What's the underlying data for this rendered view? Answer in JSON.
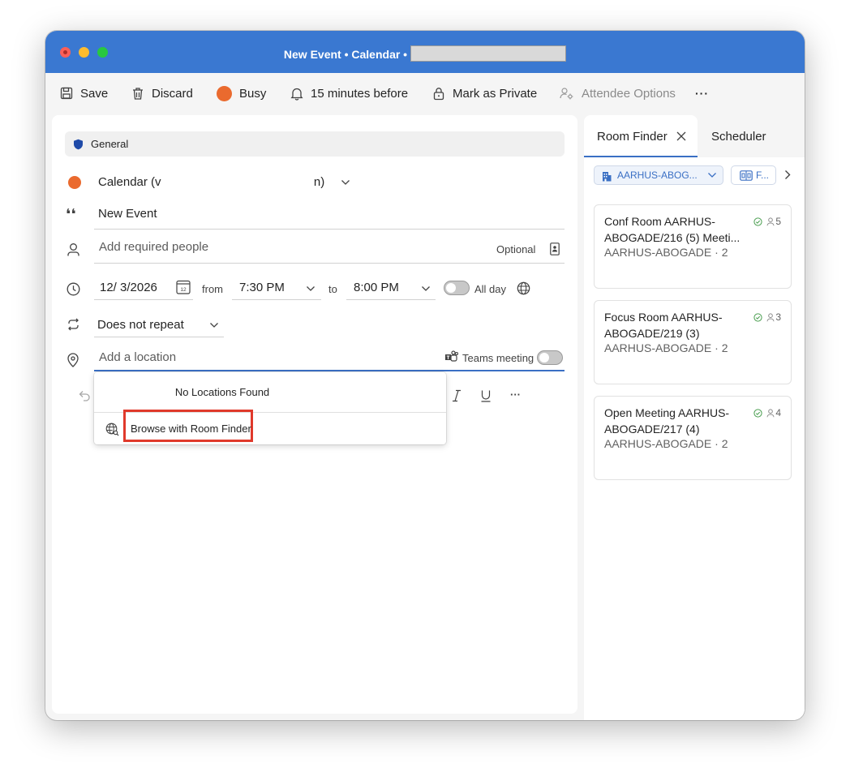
{
  "window": {
    "title": "New Event • Calendar •"
  },
  "toolbar": {
    "save": "Save",
    "discard": "Discard",
    "busy": "Busy",
    "reminder": "15 minutes before",
    "private": "Mark as Private",
    "attendee_options": "Attendee Options",
    "more": "···",
    "busy_color": "#ea6a2e"
  },
  "form": {
    "label_chip": "General",
    "calendar_name": "Calendar (v",
    "calendar_suffix": "n)",
    "calendar_color": "#ea6a2e",
    "title_value": "New Event",
    "people_placeholder": "Add required people",
    "optional_label": "Optional",
    "date_value": "12/ 3/2026",
    "from_label": "from",
    "start_time": "7:30 PM",
    "to_label": "to",
    "end_time": "8:00 PM",
    "all_day_label": "All day",
    "repeat_value": "Does not repeat",
    "location_placeholder": "Add a location",
    "teams_label": "Teams meeting",
    "more_format": "···"
  },
  "location_dropdown": {
    "empty_message": "No Locations Found",
    "browse_label": "Browse with Room Finder"
  },
  "side_panel": {
    "tabs": [
      {
        "label": "Room Finder",
        "active": true
      },
      {
        "label": "Scheduler",
        "active": false
      }
    ],
    "filter_building": "AARHUS-ABOG...",
    "filter_features": "F...",
    "rooms": [
      {
        "name": "Conf Room AARHUS-ABOGADE/216 (5) Meeti...",
        "sub": "AARHUS-ABOGADE · 2",
        "capacity": "5"
      },
      {
        "name": "Focus Room AARHUS-ABOGADE/219 (3)",
        "sub": "AARHUS-ABOGADE · 2",
        "capacity": "3"
      },
      {
        "name": "Open Meeting AARHUS-ABOGADE/217 (4)",
        "sub": "AARHUS-ABOGADE · 2",
        "capacity": "4"
      }
    ]
  }
}
